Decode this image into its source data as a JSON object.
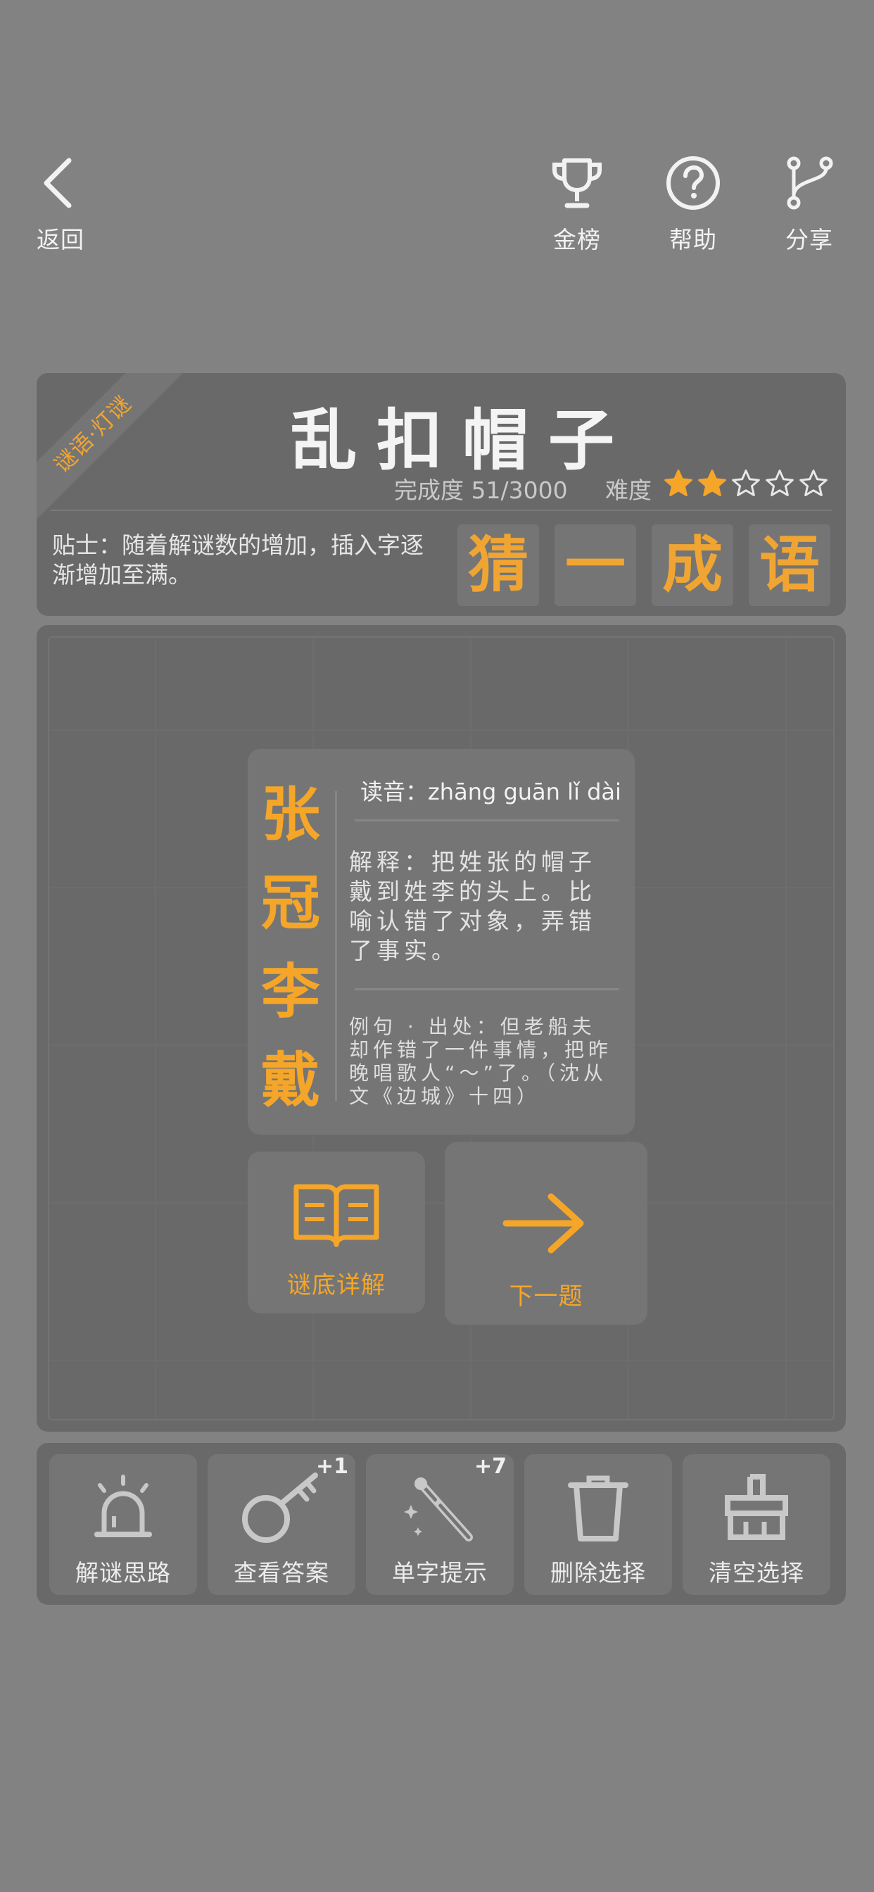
{
  "nav": {
    "back_label": "返回",
    "leaderboard_label": "金榜",
    "help_label": "帮助",
    "share_label": "分享"
  },
  "puzzle": {
    "category_ribbon": "谜语·灯谜",
    "title": "乱扣帽子",
    "progress": "完成度 51/3000",
    "difficulty_label": "难度",
    "difficulty_stars": 2,
    "difficulty_max": 5,
    "tip": "贴士：随着解谜数的增加，插入字逐渐增加至满。",
    "hint_chars": [
      "猜",
      "一",
      "成",
      "语"
    ]
  },
  "answer": {
    "idiom_chars": [
      "张",
      "冠",
      "李",
      "戴"
    ],
    "pronunciation": "读音：zhāng guān lǐ dài",
    "explanation": "解释：把姓张的帽子戴到姓李的头上。比喻认错了对象，弄错了事实。",
    "example": "例句 · 出处：但老船夫却作错了一件事情，把昨晚唱歌人“～”了。（沈从文《边城》十四）"
  },
  "actions": {
    "detail_label": "谜底详解",
    "next_label": "下一题"
  },
  "toolbar": {
    "tools": [
      {
        "label": "解谜思路",
        "icon": "alarm-icon",
        "badge": ""
      },
      {
        "label": "查看答案",
        "icon": "key-icon",
        "badge": "+1"
      },
      {
        "label": "单字提示",
        "icon": "magic-wand-icon",
        "badge": "+7"
      },
      {
        "label": "删除选择",
        "icon": "trash-icon",
        "badge": ""
      },
      {
        "label": "清空选择",
        "icon": "broom-icon",
        "badge": ""
      }
    ]
  },
  "colors": {
    "background": "#828282",
    "panel": "#696969",
    "tile": "#757575",
    "accent": "#f5a629",
    "star_empty": "#e8e8e8"
  }
}
